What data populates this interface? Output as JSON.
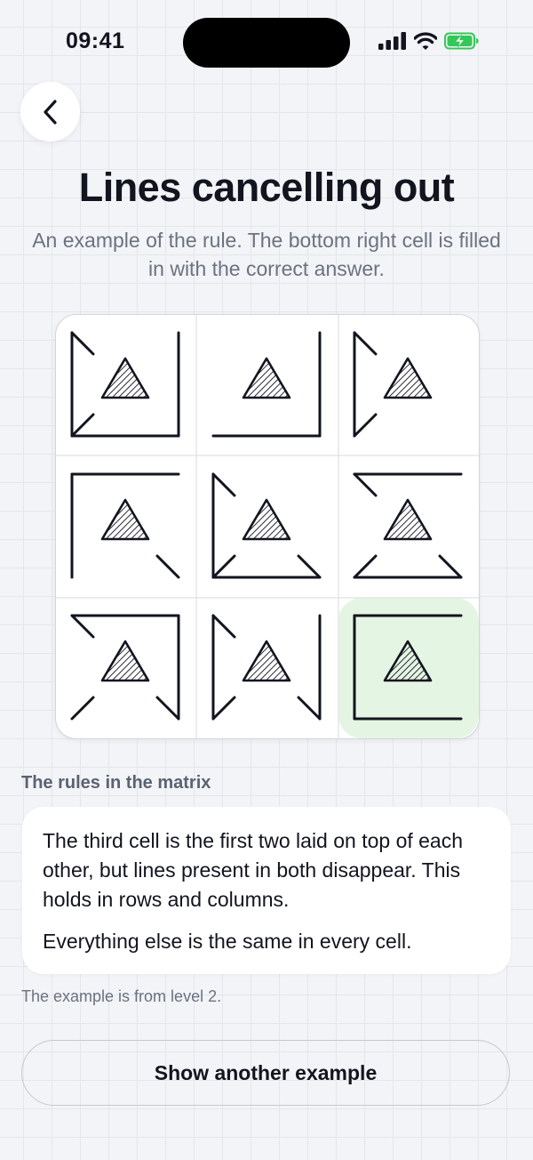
{
  "status_bar": {
    "time": "09:41",
    "icons": [
      "cellular-signal-icon",
      "wifi-icon",
      "battery-charging-icon"
    ],
    "battery_color": "#34c759"
  },
  "header": {
    "back_icon": "chevron-left-icon",
    "title": "Lines cancelling out",
    "subtitle": "An example of the rule. The bottom right cell is filled in with the correct answer."
  },
  "matrix": {
    "rows": 3,
    "cols": 3,
    "answer_cell": "bottom-right",
    "answer_highlight_color": "#e5f5e3",
    "cells": [
      {
        "row": 1,
        "col": 1,
        "lines": [
          "top-left-diagonal",
          "left",
          "right",
          "bottom",
          "bottom-left-diagonal"
        ]
      },
      {
        "row": 1,
        "col": 2,
        "lines": [
          "right",
          "bottom"
        ]
      },
      {
        "row": 1,
        "col": 3,
        "lines": [
          "top-left-diagonal",
          "left",
          "bottom-left-diagonal"
        ]
      },
      {
        "row": 2,
        "col": 1,
        "lines": [
          "top",
          "left",
          "bottom-right-diagonal"
        ]
      },
      {
        "row": 2,
        "col": 2,
        "lines": [
          "top-left-diagonal",
          "left",
          "bottom",
          "bottom-left-diagonal",
          "bottom-right-diagonal"
        ]
      },
      {
        "row": 2,
        "col": 3,
        "lines": [
          "top-left-diagonal",
          "top",
          "bottom",
          "bottom-left-diagonal",
          "bottom-right-diagonal"
        ]
      },
      {
        "row": 3,
        "col": 1,
        "lines": [
          "top-left-diagonal",
          "top",
          "right",
          "bottom-left-diagonal",
          "bottom-right-diagonal"
        ]
      },
      {
        "row": 3,
        "col": 2,
        "lines": [
          "top-left-diagonal",
          "left",
          "right",
          "bottom-left-diagonal",
          "bottom-right-diagonal"
        ]
      },
      {
        "row": 3,
        "col": 3,
        "lines": [
          "top",
          "left",
          "bottom"
        ]
      }
    ]
  },
  "rules": {
    "section_label": "The rules in the matrix",
    "paragraph_1": "The third cell is the first two laid on top of each other, but lines present in both disappear. This holds in rows and columns.",
    "paragraph_2": "Everything else is the same in every cell."
  },
  "footnote": "The example is from level 2.",
  "actions": {
    "show_another_label": "Show another example"
  }
}
